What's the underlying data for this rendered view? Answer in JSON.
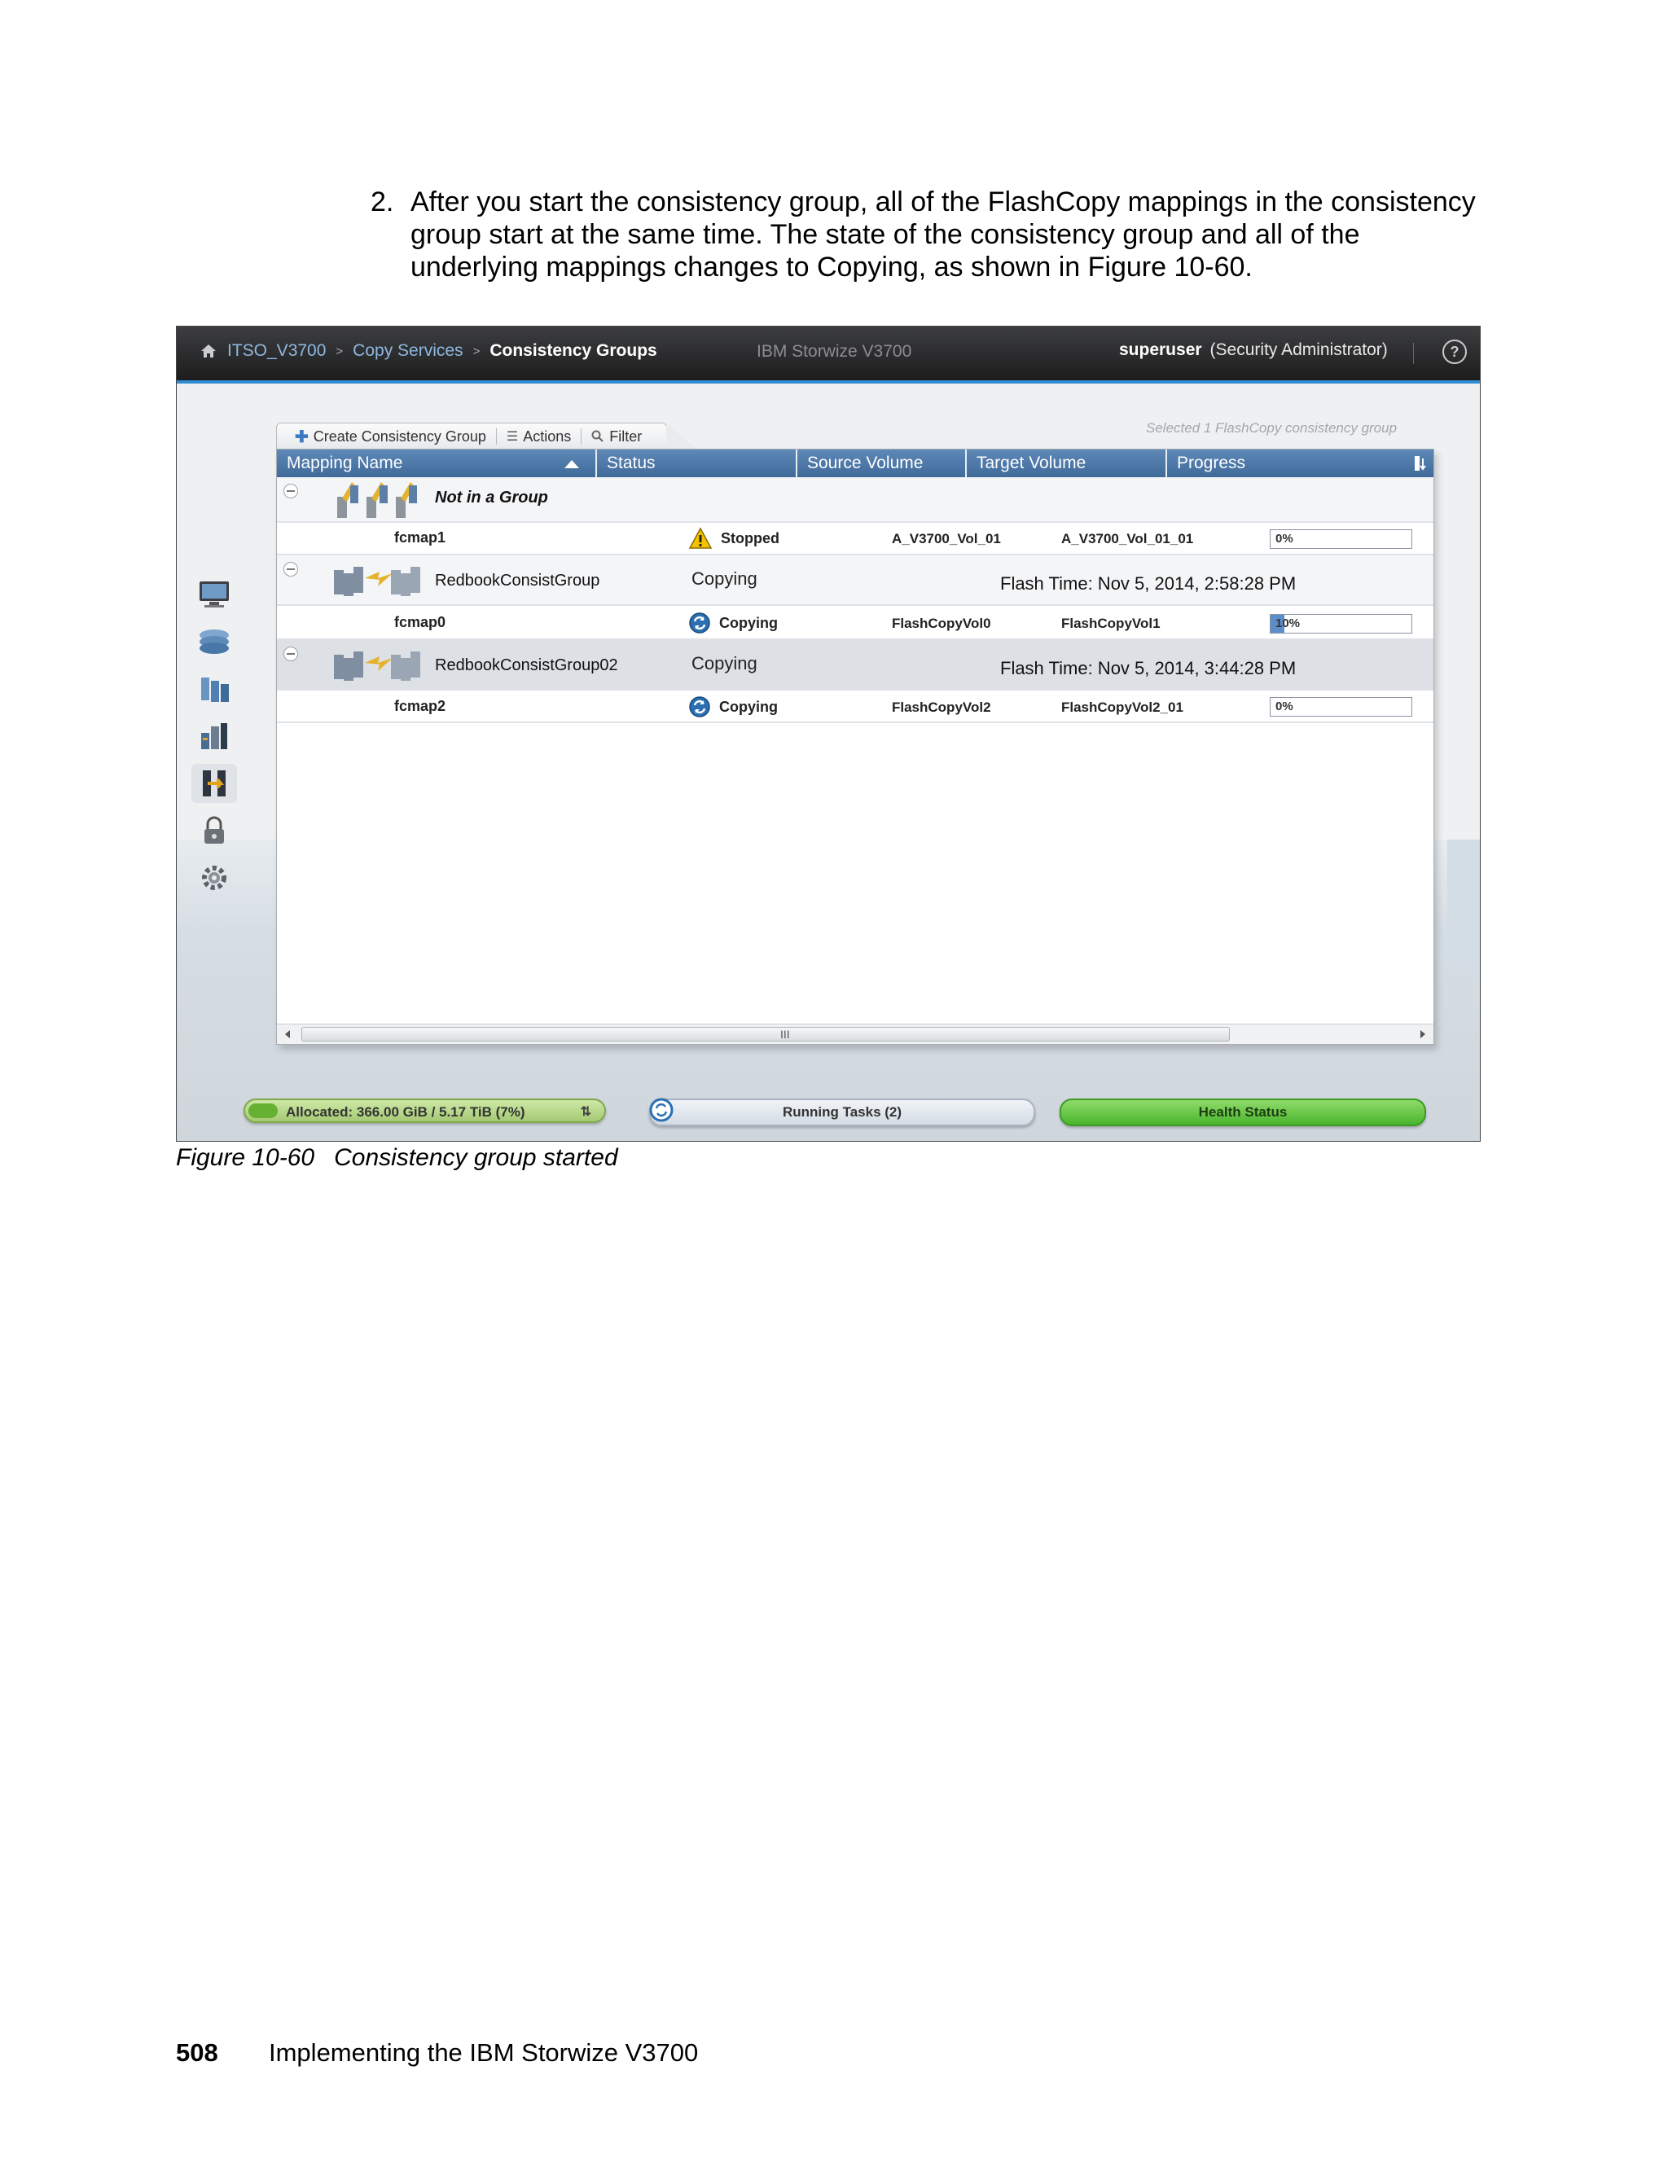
{
  "intro": {
    "number": "2.",
    "text": "After you start the consistency group, all of the FlashCopy mappings in the consistency group start at the same time. The state of the consistency group and all of the underlying mappings changes to Copying, as shown in Figure 10-60."
  },
  "app": {
    "breadcrumb": [
      "ITSO_V3700",
      "Copy Services",
      "Consistency Groups"
    ],
    "breadcrumb_sep": ">",
    "product": "IBM Storwize V3700",
    "user": "superuser",
    "role": "(Security Administrator)",
    "help_label": "?",
    "toolbar": {
      "create_label": "Create Consistency Group",
      "actions_label": "Actions",
      "filter_label": "Filter"
    },
    "selection_info": "Selected 1 FlashCopy consistency group",
    "columns": [
      "Mapping Name",
      "Status",
      "Source Volume",
      "Target Volume",
      "Progress"
    ],
    "groups": [
      {
        "name": "Not in a Group",
        "status": "",
        "flash_time": "",
        "mappings": [
          {
            "name": "fcmap1",
            "status": "Stopped",
            "status_icon": "warning-icon",
            "source": "A_V3700_Vol_01",
            "target": "A_V3700_Vol_01_01",
            "progress_label": "0%",
            "progress": 0
          }
        ]
      },
      {
        "name": "RedbookConsistGroup",
        "status": "Copying",
        "flash_time": "Flash Time: Nov 5, 2014, 2:58:28 PM",
        "mappings": [
          {
            "name": "fcmap0",
            "status": "Copying",
            "status_icon": "sync-icon",
            "source": "FlashCopyVol0",
            "target": "FlashCopyVol1",
            "progress_label": "10%",
            "progress": 10
          }
        ]
      },
      {
        "name": "RedbookConsistGroup02",
        "status": "Copying",
        "flash_time": "Flash Time: Nov 5, 2014, 3:44:28 PM",
        "mappings": [
          {
            "name": "fcmap2",
            "status": "Copying",
            "status_icon": "sync-icon",
            "source": "FlashCopyVol2",
            "target": "FlashCopyVol2_01",
            "progress_label": "0%",
            "progress": 0
          }
        ]
      }
    ],
    "scroll_grip": "III",
    "status_bar": {
      "allocated": "Allocated: 366.00 GiB / 5.17 TiB (7%)",
      "running_tasks": "Running Tasks (2)",
      "health": "Health Status"
    },
    "colors": {
      "header_blue": "#4a76a8",
      "health_green": "#4caf30",
      "accent_blue": "#2f8bd2"
    }
  },
  "caption": {
    "label": "Figure 10-60",
    "text": "Consistency group started"
  },
  "footer": {
    "page": "508",
    "title": "Implementing the IBM Storwize V3700"
  }
}
